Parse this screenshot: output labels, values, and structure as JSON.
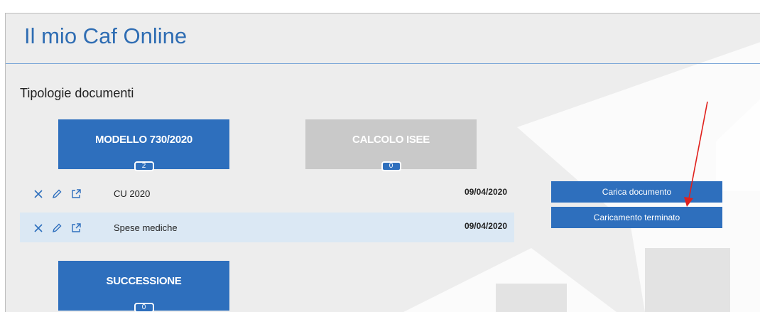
{
  "header": {
    "title": "Il mio Caf Online"
  },
  "section": {
    "label": "Tipologie documenti"
  },
  "tiles": [
    {
      "label": "MODELLO 730/2020",
      "count": "2",
      "state": "active"
    },
    {
      "label": "CALCOLO ISEE",
      "count": "0",
      "state": "disabled"
    },
    {
      "label": "SUCCESSIONE",
      "count": "0",
      "state": "active"
    }
  ],
  "documents": [
    {
      "name": "CU 2020",
      "date": "09/04/2020"
    },
    {
      "name": "Spese mediche",
      "date": "09/04/2020"
    }
  ],
  "actions": {
    "upload_label": "Carica documento",
    "finish_label": "Caricamento terminato"
  },
  "colors": {
    "primary": "#2e6fbd",
    "disabled": "#c9c9c9",
    "annotation_arrow": "#e0201c"
  },
  "icons": [
    "delete-icon",
    "edit-pencil-icon",
    "open-external-icon"
  ]
}
